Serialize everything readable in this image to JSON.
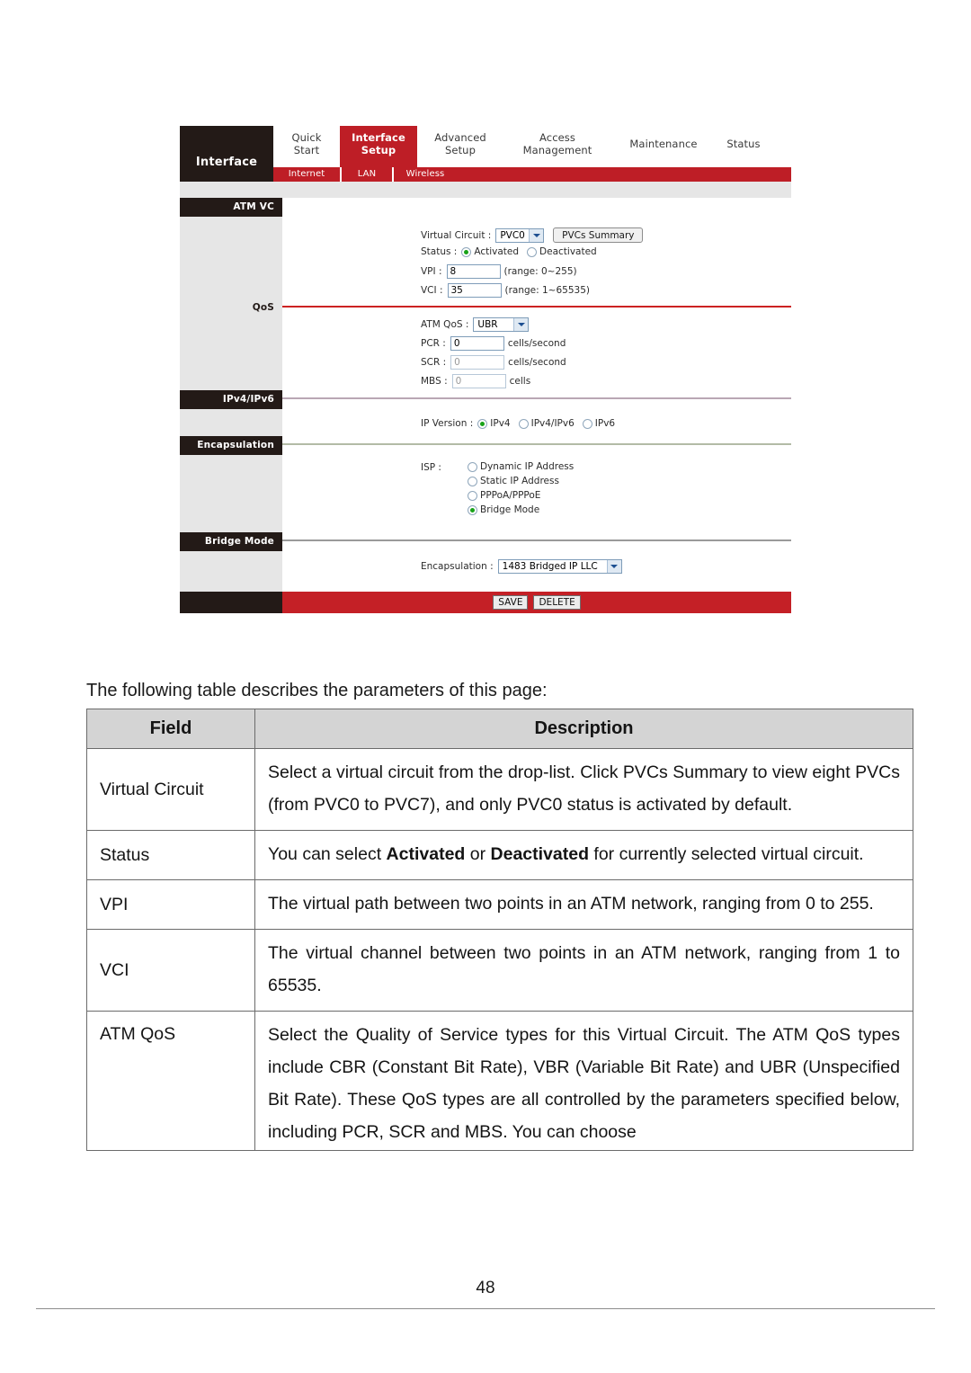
{
  "router_ui": {
    "brand": "Interface",
    "nav_tabs": [
      {
        "label": "Quick\nStart",
        "line1": "Quick",
        "line2": "Start",
        "active": false
      },
      {
        "label": "Interface Setup",
        "line1": "Interface",
        "line2": "Setup",
        "active": true
      },
      {
        "label": "Advanced Setup",
        "line1": "Advanced",
        "line2": "Setup",
        "active": false
      },
      {
        "label": "Access Management",
        "line1": "Access",
        "line2": "Management",
        "active": false
      },
      {
        "label": "Maintenance",
        "line1": "Maintenance",
        "line2": "",
        "active": false
      },
      {
        "label": "Status",
        "line1": "Status",
        "line2": "",
        "active": false
      }
    ],
    "sub_tabs": [
      {
        "label": "Internet"
      },
      {
        "label": "LAN"
      },
      {
        "label": "Wireless"
      }
    ],
    "sections": {
      "atm_vc": {
        "rail_label": "ATM VC",
        "virtual_circuit_label": "Virtual Circuit :",
        "virtual_circuit_value": "PVC0",
        "pvcs_summary_button": "PVCs Summary",
        "status_label": "Status :",
        "status_options": [
          "Activated",
          "Deactivated"
        ],
        "status_selected": "Activated",
        "vpi_label": "VPI :",
        "vpi_value": "8",
        "vpi_hint": "(range: 0~255)",
        "vci_label": "VCI :",
        "vci_value": "35",
        "vci_hint": "(range: 1~65535)"
      },
      "qos": {
        "rail_label": "QoS",
        "atm_qos_label": "ATM QoS :",
        "atm_qos_value": "UBR",
        "pcr_label": "PCR :",
        "pcr_value": "0",
        "pcr_unit": "cells/second",
        "scr_label": "SCR :",
        "scr_value": "0",
        "scr_unit": "cells/second",
        "mbs_label": "MBS :",
        "mbs_value": "0",
        "mbs_unit": "cells"
      },
      "ipv4_ipv6": {
        "rail_label": "IPv4/IPv6",
        "ip_version_label": "IP Version :",
        "ip_version_options": [
          "IPv4",
          "IPv4/IPv6",
          "IPv6"
        ],
        "ip_version_selected": "IPv4"
      },
      "encapsulation": {
        "rail_label": "Encapsulation",
        "isp_label": "ISP :",
        "isp_options": [
          "Dynamic IP Address",
          "Static IP Address",
          "PPPoA/PPPoE",
          "Bridge Mode"
        ],
        "isp_selected": "Bridge Mode"
      },
      "bridge_mode": {
        "rail_label": "Bridge Mode",
        "encapsulation_label": "Encapsulation :",
        "encapsulation_value": "1483 Bridged IP LLC"
      }
    },
    "footer_buttons": [
      "SAVE",
      "DELETE"
    ],
    "colors": {
      "red": "#be1e26",
      "dark": "#231a17",
      "grey_band": "#e6e6e6",
      "qos_divider": "#cc2222",
      "ipv4_divider": "#b9a7b4",
      "encapsulation_divider": "#b3bba6",
      "bridge_divider": "#9a9a9a"
    }
  },
  "document": {
    "intro": "The following table describes the parameters of this page:",
    "table": {
      "headers": [
        "Field",
        "Description"
      ],
      "rows": [
        {
          "field": "Virtual Circuit",
          "description": "Select a virtual circuit from the drop-list. Click PVCs Summary to view eight PVCs (from PVC0 to PVC7), and only PVC0 status is activated by default."
        },
        {
          "field": "Status",
          "description_parts": [
            {
              "text": "You can select ",
              "bold": false
            },
            {
              "text": "Activated",
              "bold": true
            },
            {
              "text": " or ",
              "bold": false
            },
            {
              "text": "Deactivated",
              "bold": true
            },
            {
              "text": " for currently selected virtual circuit.",
              "bold": false
            }
          ],
          "description": "You can select Activated or Deactivated for currently selected virtual circuit."
        },
        {
          "field": "VPI",
          "description": "The virtual path between two points in an ATM network, ranging from 0 to 255."
        },
        {
          "field": "VCI",
          "description": "The virtual channel between two points in an ATM network, ranging from 1 to 65535."
        },
        {
          "field": "ATM QoS",
          "description": "Select the Quality of Service types for this Virtual Circuit. The ATM QoS types include CBR (Constant Bit Rate), VBR (Variable Bit Rate) and UBR (Unspecified Bit Rate). These QoS types are all controlled by the parameters specified below, including PCR, SCR and MBS. You can choose"
        }
      ]
    },
    "page_number": "48"
  }
}
